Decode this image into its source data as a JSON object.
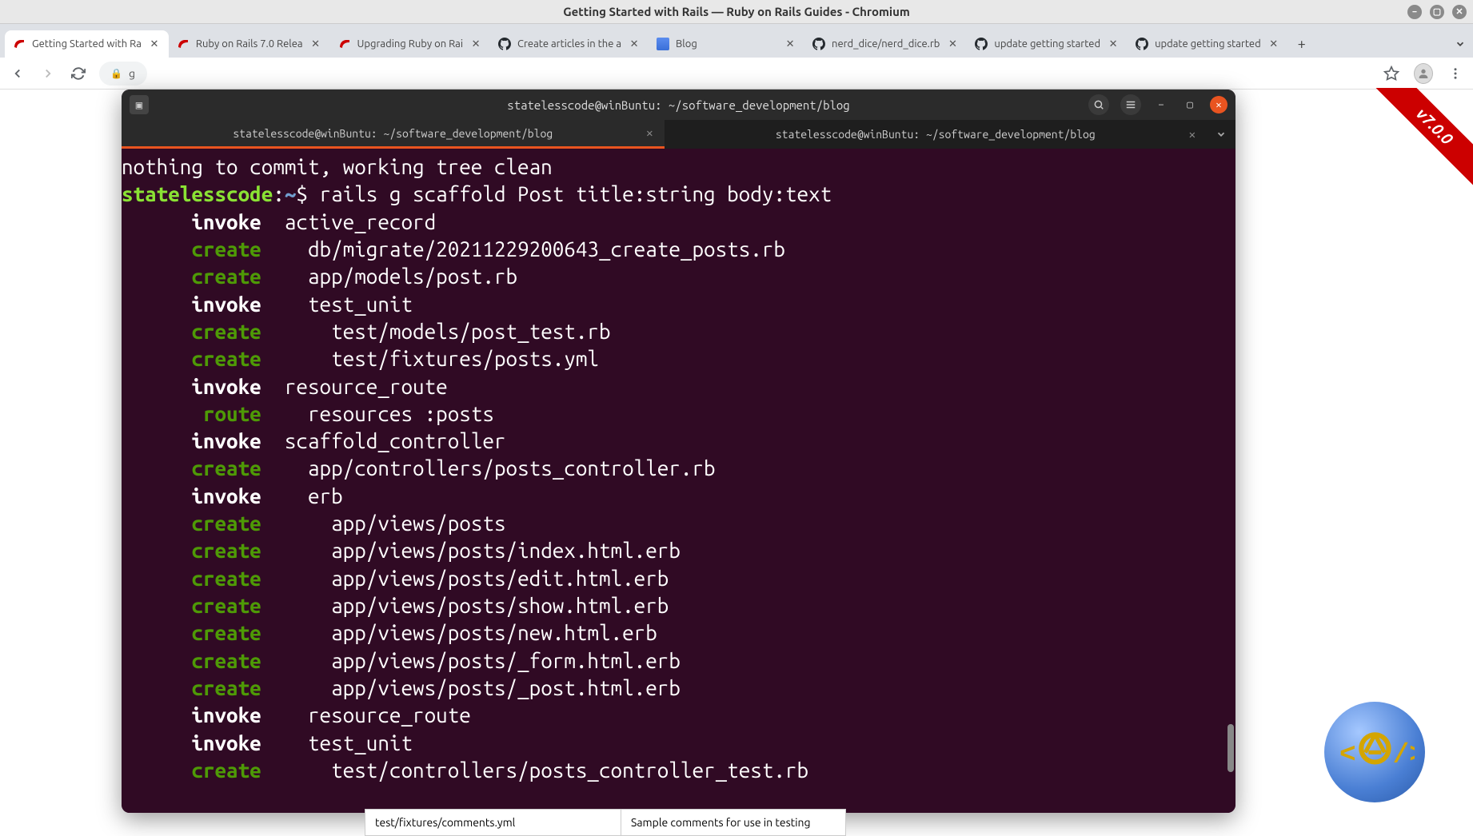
{
  "desktop": {
    "title": "Getting Started with Rails — Ruby on Rails Guides - Chromium"
  },
  "browser": {
    "tabs": [
      {
        "icon": "rails",
        "title": "Getting Started with Ra",
        "active": true
      },
      {
        "icon": "rails",
        "title": "Ruby on Rails 7.0 Relea",
        "active": false
      },
      {
        "icon": "rails",
        "title": "Upgrading Ruby on Rai",
        "active": false
      },
      {
        "icon": "github",
        "title": "Create articles in the a",
        "active": false
      },
      {
        "icon": "blog",
        "title": "Blog",
        "active": false
      },
      {
        "icon": "github",
        "title": "nerd_dice/nerd_dice.rb",
        "active": false
      },
      {
        "icon": "github",
        "title": "update getting started",
        "active": false
      },
      {
        "icon": "github",
        "title": "update getting started",
        "active": false
      }
    ],
    "url_fragment": "g"
  },
  "ribbon": {
    "version": "v7.0.0"
  },
  "terminal": {
    "title": "statelesscode@winBuntu: ~/software_development/blog",
    "tabs": [
      {
        "title": "statelesscode@winBuntu: ~/software_development/blog",
        "active": true
      },
      {
        "title": "statelesscode@winBuntu: ~/software_development/blog",
        "active": false
      }
    ],
    "git_status": "nothing to commit, working tree clean",
    "prompt_user": "statelesscode",
    "prompt_sep": ":",
    "prompt_path": "~",
    "prompt_sym": "$",
    "command": "rails g scaffold Post title:string body:text",
    "lines": [
      {
        "kw": "invoke",
        "indent": 6,
        "text": "active_record"
      },
      {
        "kw": "create",
        "indent": 6,
        "text": "  db/migrate/20211229200643_create_posts.rb"
      },
      {
        "kw": "create",
        "indent": 6,
        "text": "  app/models/post.rb"
      },
      {
        "kw": "invoke",
        "indent": 6,
        "text": "  test_unit"
      },
      {
        "kw": "create",
        "indent": 6,
        "text": "    test/models/post_test.rb"
      },
      {
        "kw": "create",
        "indent": 6,
        "text": "    test/fixtures/posts.yml"
      },
      {
        "kw": "invoke",
        "indent": 6,
        "text": "resource_route"
      },
      {
        "kw": "route",
        "indent": 7,
        "text": "  resources :posts"
      },
      {
        "kw": "invoke",
        "indent": 6,
        "text": "scaffold_controller"
      },
      {
        "kw": "create",
        "indent": 6,
        "text": "  app/controllers/posts_controller.rb"
      },
      {
        "kw": "invoke",
        "indent": 6,
        "text": "  erb"
      },
      {
        "kw": "create",
        "indent": 6,
        "text": "    app/views/posts"
      },
      {
        "kw": "create",
        "indent": 6,
        "text": "    app/views/posts/index.html.erb"
      },
      {
        "kw": "create",
        "indent": 6,
        "text": "    app/views/posts/edit.html.erb"
      },
      {
        "kw": "create",
        "indent": 6,
        "text": "    app/views/posts/show.html.erb"
      },
      {
        "kw": "create",
        "indent": 6,
        "text": "    app/views/posts/new.html.erb"
      },
      {
        "kw": "create",
        "indent": 6,
        "text": "    app/views/posts/_form.html.erb"
      },
      {
        "kw": "create",
        "indent": 6,
        "text": "    app/views/posts/_post.html.erb"
      },
      {
        "kw": "invoke",
        "indent": 6,
        "text": "  resource_route"
      },
      {
        "kw": "invoke",
        "indent": 6,
        "text": "  test_unit"
      },
      {
        "kw": "create",
        "indent": 6,
        "text": "    test/controllers/posts_controller_test.rb"
      }
    ]
  },
  "doc_row": {
    "cell1": "test/fixtures/comments.yml",
    "cell2": "Sample comments for use in testing"
  }
}
